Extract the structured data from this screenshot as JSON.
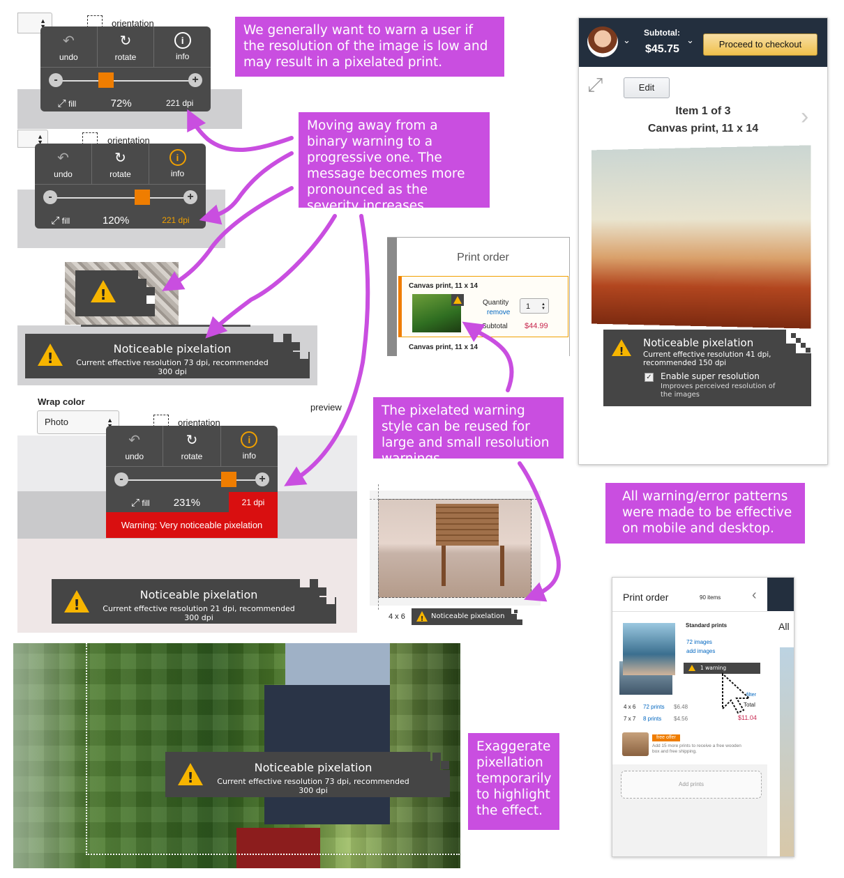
{
  "colors": {
    "accent": "#c94ee0",
    "warning_orange": "#ef7d00",
    "error_red": "#d90f10",
    "dark_bar": "#454545",
    "amazon_nav": "#232f3e",
    "checkout_yellow": "#f0c14b",
    "price_red": "#b12704"
  },
  "notes": {
    "n1": "We generally want to warn a user if the resolution of the image is low and may result in a pixelated print.",
    "n2": "Moving away from a binary warning to a progressive one. The message becomes more pronounced as the severity increases.",
    "n3": "The pixelated warning style can be reused for large and small resolution warnings.",
    "n4": "All warning/error patterns were made to be effective on mobile and desktop.",
    "n5": "Exaggerate pixellation temporarily to highlight the effect."
  },
  "editor1": {
    "orientation": "orientation",
    "undo": "undo",
    "rotate": "rotate",
    "info": "info",
    "fill": "fill",
    "zoom": "72%",
    "dpi": "221 dpi"
  },
  "editor2": {
    "orientation": "orientation",
    "undo": "undo",
    "rotate": "rotate",
    "info": "info",
    "fill": "fill",
    "zoom": "120%",
    "dpi": "221 dpi"
  },
  "editor3": {
    "wrap_label": "Wrap color",
    "wrap_value": "Photo",
    "preview": "preview",
    "orientation": "orientation",
    "undo": "undo",
    "rotate": "rotate",
    "info": "info",
    "fill": "fill",
    "zoom": "231%",
    "dpi": "21 dpi",
    "error": "Warning: Very noticeable pixelation"
  },
  "warn1": {
    "title": "Noticeable pixelation",
    "detail": "Current effective resolution 73 dpi, recommended 300 dpi"
  },
  "warn2": {
    "title": "Noticeable pixelation",
    "detail": "Current effective resolution 21 dpi, recommended 300 dpi"
  },
  "warn3": {
    "title": "Noticeable pixelation",
    "detail": "Current effective resolution 73 dpi, recommended 300 dpi"
  },
  "print_order": {
    "title": "Print order",
    "item": "Canvas print, 11 x 14",
    "quantity_label": "Quantity",
    "quantity": "1",
    "remove": "remove",
    "subtotal_label": "Subtotal",
    "subtotal": "$44.99",
    "item2": "Canvas print, 11 x 14"
  },
  "small_preview": {
    "size": "4 x 6",
    "warning": "Noticeable pixelation"
  },
  "mobile": {
    "subtotal_label": "Subtotal:",
    "subtotal": "$45.75",
    "checkout": "Proceed to checkout",
    "edit": "Edit",
    "item_count": "Item 1 of 3",
    "item_name": "Canvas print, 11 x 14",
    "warn_title": "Noticeable pixelation",
    "warn_detail": "Current effective resolution 41 dpi, recommended 150 dpi",
    "super_title": "Enable super resolution",
    "super_detail": "Improves perceived resolution of the images"
  },
  "order_panel": {
    "title": "Print order",
    "items": "90 items",
    "section": "Standard prints",
    "images": "72 images",
    "add_images": "add images",
    "warning": "1 warning",
    "rows": [
      {
        "size": "4 x 6",
        "prints": "72 prints",
        "price": "$6.48"
      },
      {
        "size": "7 x 7",
        "prints": "8 prints",
        "price": "$4.56"
      }
    ],
    "filter": "filter",
    "total": "Total",
    "total_value": "$11.04",
    "offer_badge": "free offer",
    "offer_text": "Add 15 more prints to receive a free wooden box and free shipping.",
    "add_prints": "Add prints",
    "right_label": "All"
  }
}
